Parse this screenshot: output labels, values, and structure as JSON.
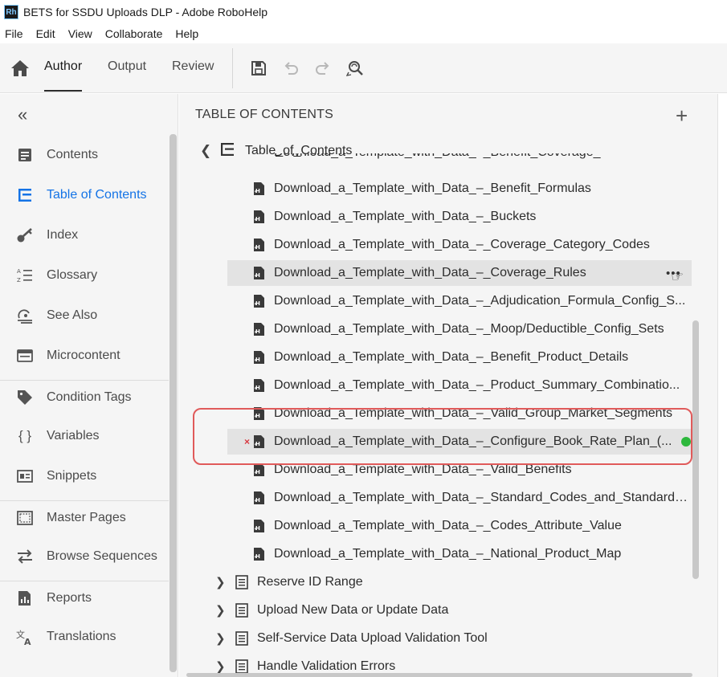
{
  "window": {
    "title": "BETS for SSDU Uploads DLP - Adobe RoboHelp",
    "logo": "Rh"
  },
  "menu": [
    "File",
    "Edit",
    "View",
    "Collaborate",
    "Help"
  ],
  "toolbar": {
    "tabs": {
      "author": "Author",
      "output": "Output",
      "review": "Review"
    },
    "active_tab": "Author",
    "icons": [
      "home-icon",
      "save-icon",
      "undo-icon",
      "redo-icon",
      "find-replace-icon"
    ]
  },
  "sidebar": {
    "items": [
      {
        "label": "Contents",
        "icon": "contents-icon"
      },
      {
        "label": "Table of Contents",
        "icon": "toc-icon",
        "active": true
      },
      {
        "label": "Index",
        "icon": "key-icon"
      },
      {
        "label": "Glossary",
        "icon": "glossary-icon"
      },
      {
        "label": "See Also",
        "icon": "see-also-icon"
      },
      {
        "label": "Microcontent",
        "icon": "microcontent-icon"
      },
      {
        "label": "Condition Tags",
        "icon": "tag-icon"
      },
      {
        "label": "Variables",
        "icon": "braces-icon"
      },
      {
        "label": "Snippets",
        "icon": "snippet-icon"
      },
      {
        "label": "Master Pages",
        "icon": "master-page-icon"
      },
      {
        "label": "Browse Sequences",
        "icon": "arrows-icon"
      },
      {
        "label": "Reports",
        "icon": "report-icon"
      },
      {
        "label": "Translations",
        "icon": "translate-icon"
      }
    ],
    "accent": "#1473e6"
  },
  "toc": {
    "heading": "TABLE OF CONTENTS",
    "root": "Table_of_Contents",
    "topics": [
      "Download_a_Template_with_Data_–_Benefit_Formulas",
      "Download_a_Template_with_Data_–_Buckets",
      "Download_a_Template_with_Data_–_Coverage_Category_Codes",
      "Download_a_Template_with_Data_–_Coverage_Rules",
      "Download_a_Template_with_Data_–_Adjudication_Formula_Config_S...",
      "Download_a_Template_with_Data_–_Moop/Deductible_Config_Sets",
      "Download_a_Template_with_Data_–_Benefit_Product_Details",
      "Download_a_Template_with_Data_–_Product_Summary_Combinatio...",
      "Download_a_Template_with_Data_–_Valid_Group_Market_Segments",
      "Download_a_Template_with_Data_–_Configure_Book_Rate_Plan_(...",
      "Download_a_Template_with_Data_–_Valid_Benefits",
      "Download_a_Template_with_Data_–_Standard_Codes_and_Standard_...",
      "Download_a_Template_with_Data_–_Codes_Attribute_Value",
      "Download_a_Template_with_Data_–_National_Product_Map"
    ],
    "partial_topic": "Download_a_Template_with_Data_–_Benefit_Coverage_",
    "hovered_index": 3,
    "selected_index": 9,
    "books": [
      "Reserve ID Range",
      "Upload New Data or Update Data",
      "Self-Service Data Upload Validation Tool",
      "Handle Validation Errors"
    ],
    "more_glyph": "•••",
    "status_error_glyph": "×",
    "status_ok_color": "#2db83d",
    "highlight_color": "#e05a5a"
  }
}
